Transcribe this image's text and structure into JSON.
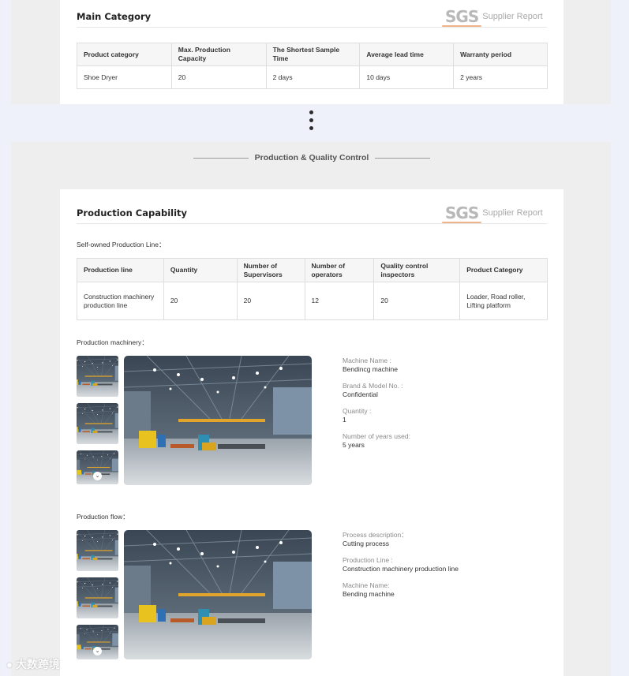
{
  "main_category": {
    "title": "Main Category",
    "sgs_logo": "SGS",
    "sgs_label": "Supplier Report",
    "headers": [
      "Product category",
      "Max. Production Capacity",
      "The Shortest Sample Time",
      "Average lead time",
      "Warranty period"
    ],
    "row": [
      "Shoe Dryer",
      "20",
      "2 days",
      "10 days",
      "2 years"
    ]
  },
  "section_title": "Production & Quality Control",
  "production_capability": {
    "title": "Production Capability",
    "sgs_logo": "SGS",
    "sgs_label": "Supplier Report",
    "line_label": "Self-owned Production Line：",
    "headers": [
      "Production line",
      "Quantity",
      "Number of Supervisors",
      "Number of operators",
      "Quality control inspectors",
      "Product Category"
    ],
    "row": [
      "Construction machinery production line",
      "20",
      "20",
      "12",
      "20",
      "Loader, Road roller, Lifting platform"
    ]
  },
  "machinery": {
    "label": "Production machinery：",
    "fields": [
      {
        "key": "Machine Name :",
        "value": "Bendincg machine"
      },
      {
        "key": "Brand & Model No. :",
        "value": "Confidential"
      },
      {
        "key": "Quantity :",
        "value": "1"
      },
      {
        "key": "Number of years used:",
        "value": "5 years"
      }
    ]
  },
  "flow": {
    "label": "Production flow：",
    "fields": [
      {
        "key": "Process description：",
        "value": "Cutting process"
      },
      {
        "key": "Production Line :",
        "value": "Construction machinery production line"
      },
      {
        "key": "Machine Name:",
        "value": "Bending machine"
      }
    ]
  },
  "icons": {
    "more": "vertical-ellipsis-icon",
    "expand": "chevron-down-icon",
    "watermark_logo": "brand-logo-icon"
  },
  "watermark_text": "大数跨境",
  "colors": {
    "sgs_accent": "#f0b48a",
    "page_bg": "#eef1fa",
    "panel_bg": "#eeeeee"
  }
}
